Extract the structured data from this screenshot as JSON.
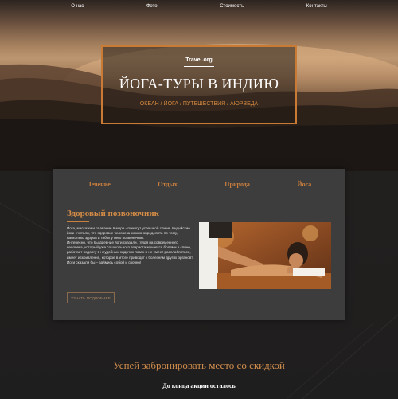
{
  "nav": {
    "items": [
      "О нас",
      "Фото",
      "Стоимость",
      "Контакты"
    ]
  },
  "hero": {
    "brand": "Travel.org",
    "title": "ЙОГА-ТУРЫ В ИНДИЮ",
    "tags": "ОКЕАН / ЙОГА / ПУТЕШЕСТВИЯ / АЮРВЕДА"
  },
  "card": {
    "tabs": [
      "Лечение",
      "Отдых",
      "Природа",
      "Йога"
    ],
    "section_title": "Здоровый позвоночник",
    "paragraph1": "Йога, массажи и плавание в море - помогут успешной спине! Индийские йоги считали, что здоровье человека можно определить по тому, насколько здоров и гибок у него позвоночник.",
    "paragraph2": "Интересно, что бы древние йоги сказали, глядя на современного человека, который уже со школьного возраста мучается болями в спине, работает подолгу в неудобных сидячих позах и не умеет расслабляться, имеет искривления, которое в итоге приводят к болезням других органов? Йоги сказали бы – займись собой и срочно!",
    "button_label": "УЗНАТЬ ПОДРОБНЕЕ"
  },
  "promo": {
    "title": "Успей забронировать место со скидкой",
    "subtitle": "До конца акции осталось"
  },
  "colors": {
    "accent": "#c97f3e",
    "card_bg": "#3e3d3d",
    "page_bg": "#1d1b1a"
  }
}
